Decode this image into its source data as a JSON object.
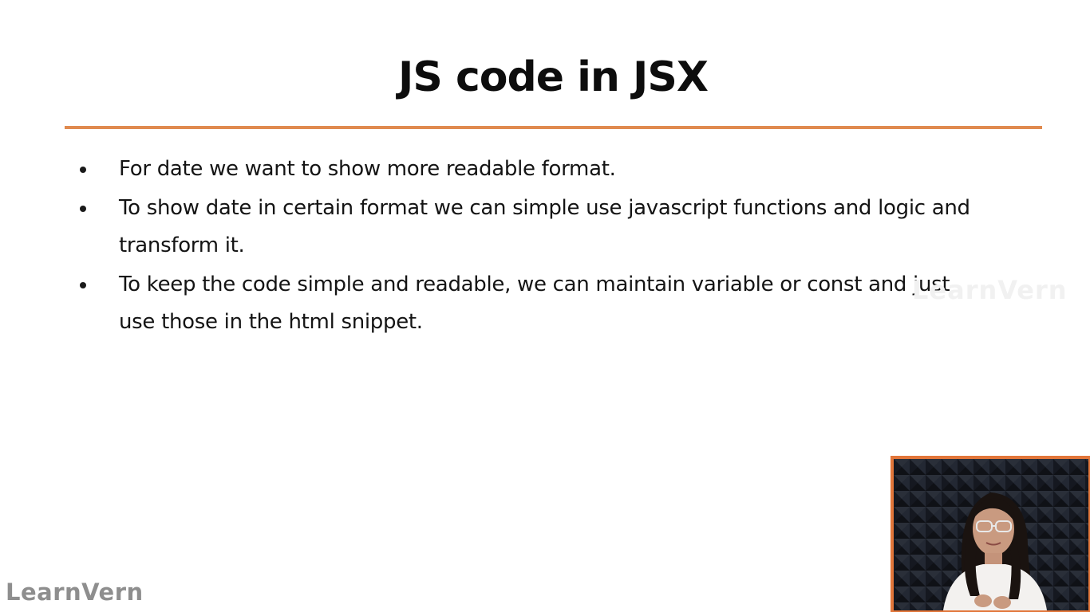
{
  "slide": {
    "title": "JS code in JSX",
    "bullets": [
      "For date we want to show more readable format.",
      "To show date in certain format we can simple use javascript functions and logic and transform it.",
      "To keep the code simple and readable, we can maintain variable or const and just use those in the html snippet."
    ]
  },
  "watermarks": {
    "faint": "LearnVern",
    "logo": "LearnVern"
  },
  "colors": {
    "accent": "#e08a4f",
    "webcam_border": "#e2763a",
    "text": "#141414",
    "logo": "#8e8e8e"
  },
  "icons": {
    "bullet": "bullet-dot-icon"
  }
}
